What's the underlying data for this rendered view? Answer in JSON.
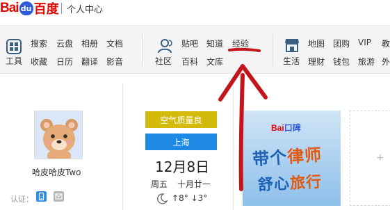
{
  "header": {
    "logo_latin": "Bai",
    "logo_paw": "du",
    "logo_cn": "百度",
    "title": "个人中心"
  },
  "nav": {
    "tools": {
      "label": "工具",
      "icon": "grid-tools-icon",
      "links": [
        "搜索",
        "云盘",
        "相册",
        "文档",
        "收藏",
        "日历",
        "翻译",
        "影音"
      ]
    },
    "community": {
      "label": "社区",
      "icon": "people-icon",
      "links": [
        "贴吧",
        "知道",
        "经验",
        "百科",
        "文库"
      ]
    },
    "life": {
      "label": "生活",
      "icon": "shop-icon",
      "links": [
        "地图",
        "团购",
        "VIP",
        "教",
        "理财",
        "钱包",
        "旅游",
        "外"
      ]
    }
  },
  "profile": {
    "username": "哈皮哈皮Two",
    "verify_label": "认证：",
    "verify_icons": [
      "phone-verify-icon",
      "email-verify-icon"
    ]
  },
  "weather": {
    "air_quality": "空气质量良",
    "city": "上海",
    "date": "12月8日",
    "weekday": "周五",
    "lunar_date": "十月廿一",
    "temperature": "8° ↓3°",
    "temp_icon": "moon-icon"
  },
  "banner": {
    "logo": "Bai",
    "logo_suffix": "口碑",
    "line1_a": "带个",
    "line1_b": "律师",
    "line2_a": "舒心",
    "line2_b": "旅行"
  },
  "add_card": {
    "plus": "+"
  },
  "colors": {
    "brand_red": "#e10601",
    "brand_blue": "#2e5bd6",
    "air_yellow": "#d4bb0b",
    "city_blue": "#1f8ae6",
    "annotation_red": "#c2161b"
  }
}
